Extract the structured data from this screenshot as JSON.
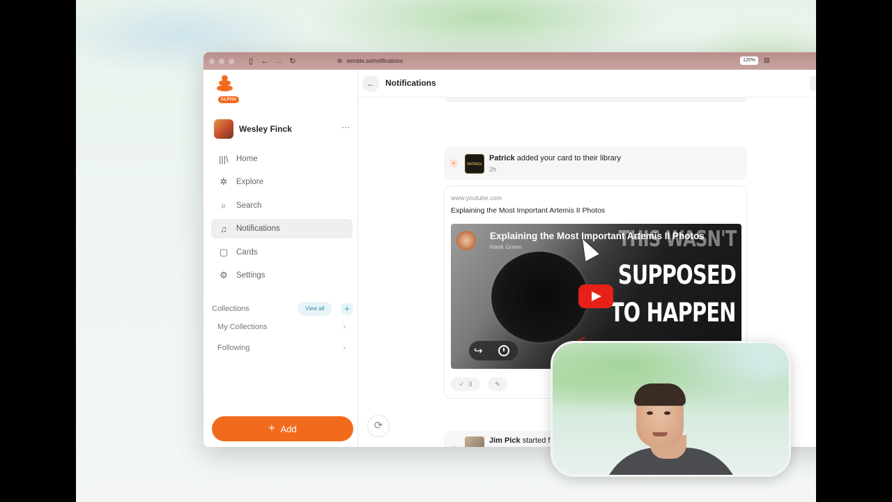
{
  "browser": {
    "url": "semble.so/notifications",
    "zoom": "120%"
  },
  "sidebar": {
    "badge": "ALPHA",
    "user": {
      "name": "Wesley Finck",
      "menu": "···"
    },
    "nav": [
      {
        "label": "Home",
        "icon": "library-icon"
      },
      {
        "label": "Explore",
        "icon": "explore-icon"
      },
      {
        "label": "Search",
        "icon": "search-icon"
      },
      {
        "label": "Notifications",
        "icon": "bell-icon",
        "active": true
      },
      {
        "label": "Cards",
        "icon": "card-icon"
      },
      {
        "label": "Settings",
        "icon": "gear-icon"
      }
    ],
    "collections": {
      "title": "Collections",
      "view_all": "View all",
      "add": "+",
      "items": [
        {
          "label": "My Collections"
        },
        {
          "label": "Following"
        }
      ]
    },
    "add_button": "Add",
    "accent": "#f26b1d"
  },
  "header": {
    "title": "Notifications"
  },
  "notifications": [
    {
      "actor": "Patrick",
      "action": " added your card to their library",
      "time": "2h",
      "avatar_text": "PATRICK",
      "card": {
        "domain": "www.youtube.com",
        "title": "Explaining the Most Important Artemis II Photos",
        "video": {
          "title": "Explaining the Most Important Artemis II Photos",
          "channel": "Hank Green",
          "overlay_line1": "THIS WASN'T",
          "overlay_line2": "SUPPOSED",
          "overlay_line3": "TO HAPPEN"
        },
        "likes": "3"
      }
    },
    {
      "actor": "Jim Pick",
      "action": " started following you"
    }
  ]
}
